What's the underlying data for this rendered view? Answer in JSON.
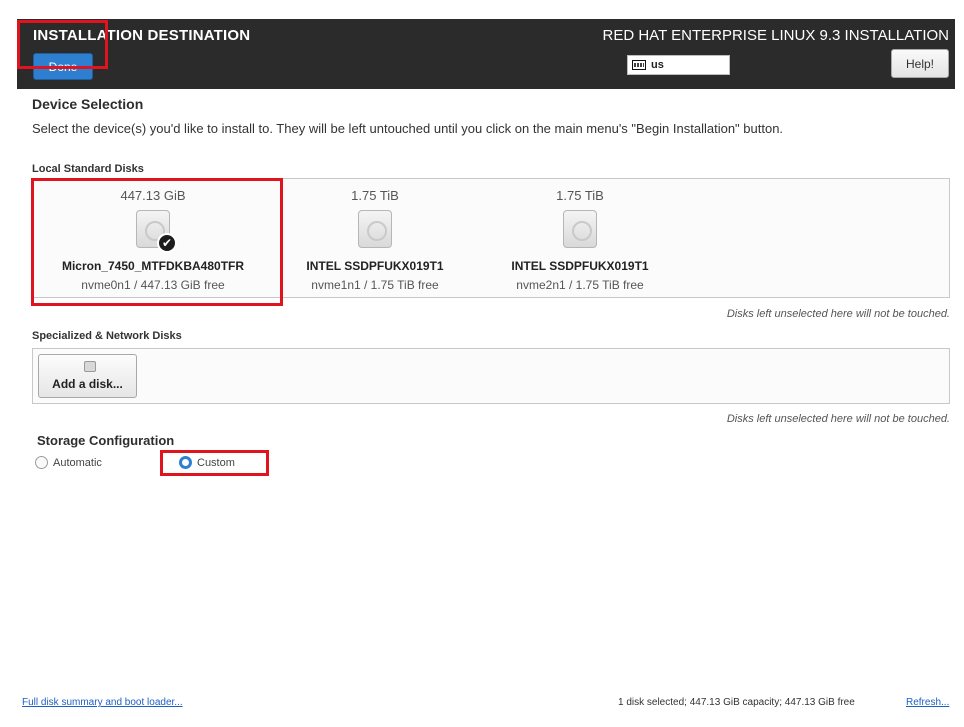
{
  "header": {
    "title": "INSTALLATION DESTINATION",
    "product": "RED HAT ENTERPRISE LINUX 9.3 INSTALLATION",
    "done_label": "Done",
    "keyboard_layout": "us",
    "help_label": "Help!"
  },
  "device_selection": {
    "heading": "Device Selection",
    "description": "Select the device(s) you'd like to install to.  They will be left untouched until you click on the main menu's \"Begin Installation\" button."
  },
  "local_disks": {
    "heading": "Local Standard Disks",
    "disks": [
      {
        "size": "447.13 GiB",
        "name": "Micron_7450_MTFDKBA480TFR",
        "free": "nvme0n1  /  447.13 GiB free",
        "selected": true
      },
      {
        "size": "1.75 TiB",
        "name": "INTEL SSDPFUKX019T1",
        "free": "nvme1n1  /  1.75 TiB free",
        "selected": false
      },
      {
        "size": "1.75 TiB",
        "name": "INTEL SSDPFUKX019T1",
        "free": "nvme2n1  /  1.75 TiB free",
        "selected": false
      }
    ],
    "note": "Disks left unselected here will not be touched."
  },
  "specialized_disks": {
    "heading": "Specialized & Network Disks",
    "add_label": "Add a disk...",
    "note": "Disks left unselected here will not be touched."
  },
  "storage_config": {
    "heading": "Storage Configuration",
    "options": [
      {
        "label": "Automatic",
        "selected": false
      },
      {
        "label": "Custom",
        "selected": true
      }
    ]
  },
  "footer": {
    "summary_link": "Full disk summary and boot loader...",
    "status": "1 disk selected; 447.13 GiB capacity; 447.13 GiB free",
    "refresh_link": "Refresh..."
  },
  "colors": {
    "header_bg": "#2b2b2b",
    "accent": "#2f7fd1",
    "highlight": "#e0141e"
  }
}
